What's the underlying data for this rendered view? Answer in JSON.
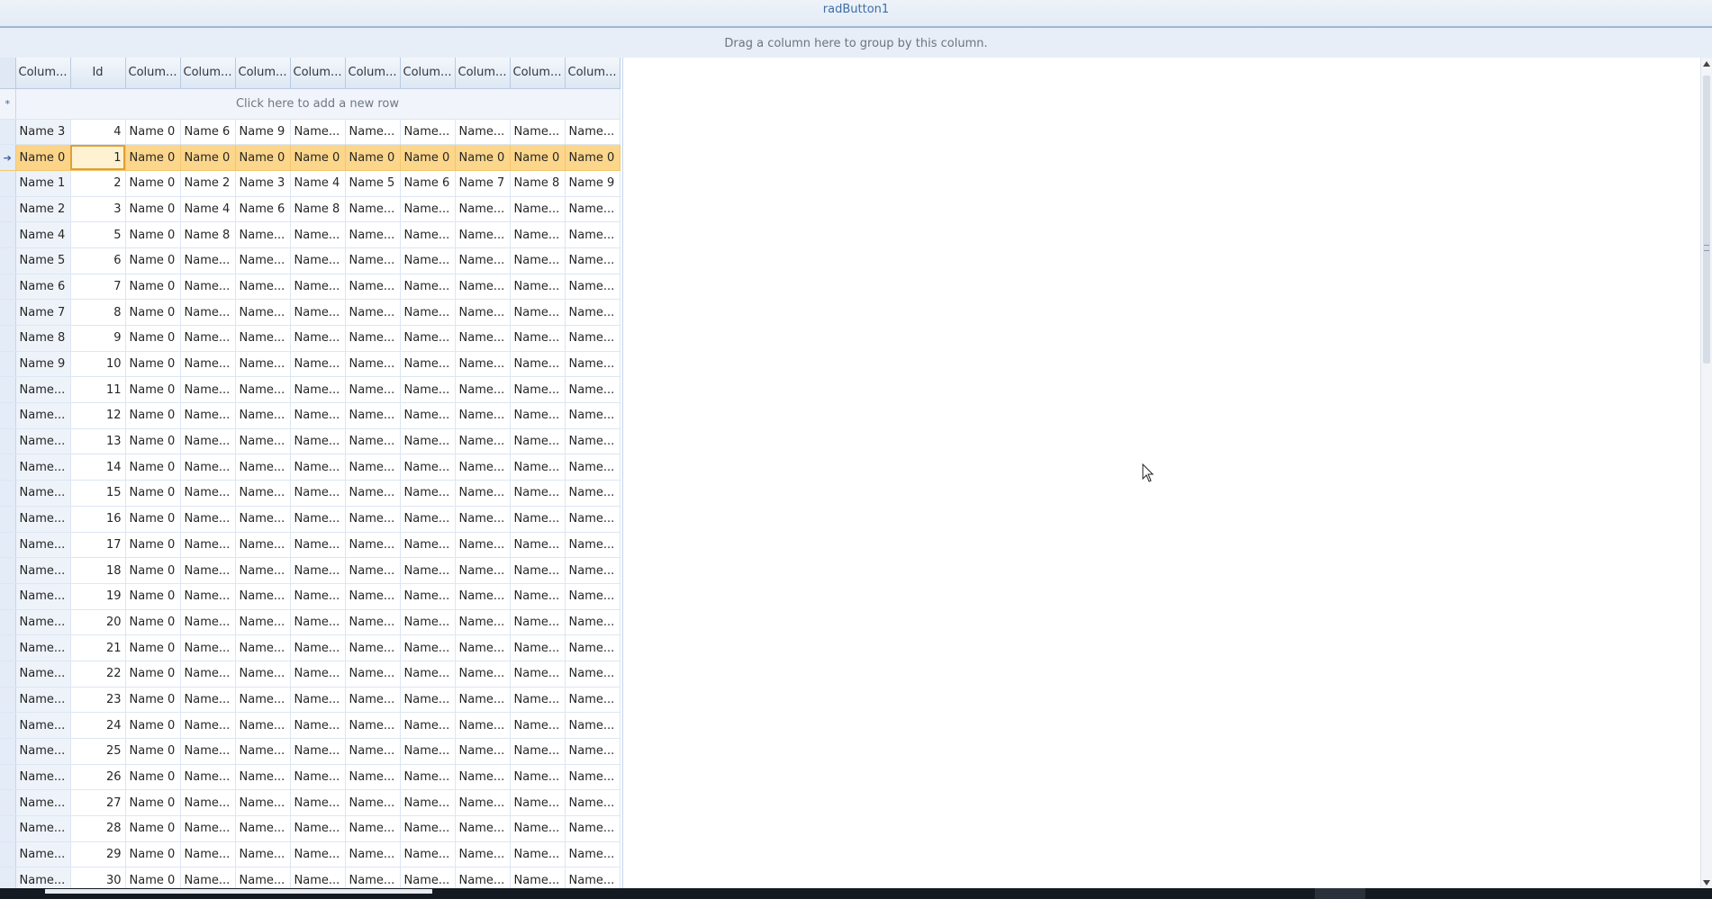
{
  "top_button": {
    "label": "radButton1"
  },
  "group_panel": {
    "text": "Drag a column here to group by this column."
  },
  "grid": {
    "columns": [
      "Colum...",
      "Id",
      "Colum...",
      "Colum...",
      "Colum...",
      "Colum...",
      "Colum...",
      "Colum...",
      "Colum...",
      "Colum...",
      "Colum..."
    ],
    "new_row_text": "Click here to add a new row",
    "new_row_marker": "*",
    "current_row_marker": "➔",
    "current_row_index": 1,
    "rows": [
      [
        "Name 3",
        "4",
        "Name 0",
        "Name 6",
        "Name 9",
        "Name...",
        "Name...",
        "Name...",
        "Name...",
        "Name...",
        "Name..."
      ],
      [
        "Name 0",
        "1",
        "Name 0",
        "Name 0",
        "Name 0",
        "Name 0",
        "Name 0",
        "Name 0",
        "Name 0",
        "Name 0",
        "Name 0"
      ],
      [
        "Name 1",
        "2",
        "Name 0",
        "Name 2",
        "Name 3",
        "Name 4",
        "Name 5",
        "Name 6",
        "Name 7",
        "Name 8",
        "Name 9"
      ],
      [
        "Name 2",
        "3",
        "Name 0",
        "Name 4",
        "Name 6",
        "Name 8",
        "Name...",
        "Name...",
        "Name...",
        "Name...",
        "Name..."
      ],
      [
        "Name 4",
        "5",
        "Name 0",
        "Name 8",
        "Name...",
        "Name...",
        "Name...",
        "Name...",
        "Name...",
        "Name...",
        "Name..."
      ],
      [
        "Name 5",
        "6",
        "Name 0",
        "Name...",
        "Name...",
        "Name...",
        "Name...",
        "Name...",
        "Name...",
        "Name...",
        "Name..."
      ],
      [
        "Name 6",
        "7",
        "Name 0",
        "Name...",
        "Name...",
        "Name...",
        "Name...",
        "Name...",
        "Name...",
        "Name...",
        "Name..."
      ],
      [
        "Name 7",
        "8",
        "Name 0",
        "Name...",
        "Name...",
        "Name...",
        "Name...",
        "Name...",
        "Name...",
        "Name...",
        "Name..."
      ],
      [
        "Name 8",
        "9",
        "Name 0",
        "Name...",
        "Name...",
        "Name...",
        "Name...",
        "Name...",
        "Name...",
        "Name...",
        "Name..."
      ],
      [
        "Name 9",
        "10",
        "Name 0",
        "Name...",
        "Name...",
        "Name...",
        "Name...",
        "Name...",
        "Name...",
        "Name...",
        "Name..."
      ],
      [
        "Name...",
        "11",
        "Name 0",
        "Name...",
        "Name...",
        "Name...",
        "Name...",
        "Name...",
        "Name...",
        "Name...",
        "Name..."
      ],
      [
        "Name...",
        "12",
        "Name 0",
        "Name...",
        "Name...",
        "Name...",
        "Name...",
        "Name...",
        "Name...",
        "Name...",
        "Name..."
      ],
      [
        "Name...",
        "13",
        "Name 0",
        "Name...",
        "Name...",
        "Name...",
        "Name...",
        "Name...",
        "Name...",
        "Name...",
        "Name..."
      ],
      [
        "Name...",
        "14",
        "Name 0",
        "Name...",
        "Name...",
        "Name...",
        "Name...",
        "Name...",
        "Name...",
        "Name...",
        "Name..."
      ],
      [
        "Name...",
        "15",
        "Name 0",
        "Name...",
        "Name...",
        "Name...",
        "Name...",
        "Name...",
        "Name...",
        "Name...",
        "Name..."
      ],
      [
        "Name...",
        "16",
        "Name 0",
        "Name...",
        "Name...",
        "Name...",
        "Name...",
        "Name...",
        "Name...",
        "Name...",
        "Name..."
      ],
      [
        "Name...",
        "17",
        "Name 0",
        "Name...",
        "Name...",
        "Name...",
        "Name...",
        "Name...",
        "Name...",
        "Name...",
        "Name..."
      ],
      [
        "Name...",
        "18",
        "Name 0",
        "Name...",
        "Name...",
        "Name...",
        "Name...",
        "Name...",
        "Name...",
        "Name...",
        "Name..."
      ],
      [
        "Name...",
        "19",
        "Name 0",
        "Name...",
        "Name...",
        "Name...",
        "Name...",
        "Name...",
        "Name...",
        "Name...",
        "Name..."
      ],
      [
        "Name...",
        "20",
        "Name 0",
        "Name...",
        "Name...",
        "Name...",
        "Name...",
        "Name...",
        "Name...",
        "Name...",
        "Name..."
      ],
      [
        "Name...",
        "21",
        "Name 0",
        "Name...",
        "Name...",
        "Name...",
        "Name...",
        "Name...",
        "Name...",
        "Name...",
        "Name..."
      ],
      [
        "Name...",
        "22",
        "Name 0",
        "Name...",
        "Name...",
        "Name...",
        "Name...",
        "Name...",
        "Name...",
        "Name...",
        "Name..."
      ],
      [
        "Name...",
        "23",
        "Name 0",
        "Name...",
        "Name...",
        "Name...",
        "Name...",
        "Name...",
        "Name...",
        "Name...",
        "Name..."
      ],
      [
        "Name...",
        "24",
        "Name 0",
        "Name...",
        "Name...",
        "Name...",
        "Name...",
        "Name...",
        "Name...",
        "Name...",
        "Name..."
      ],
      [
        "Name...",
        "25",
        "Name 0",
        "Name...",
        "Name...",
        "Name...",
        "Name...",
        "Name...",
        "Name...",
        "Name...",
        "Name..."
      ],
      [
        "Name...",
        "26",
        "Name 0",
        "Name...",
        "Name...",
        "Name...",
        "Name...",
        "Name...",
        "Name...",
        "Name...",
        "Name..."
      ],
      [
        "Name...",
        "27",
        "Name 0",
        "Name...",
        "Name...",
        "Name...",
        "Name...",
        "Name...",
        "Name...",
        "Name...",
        "Name..."
      ],
      [
        "Name...",
        "28",
        "Name 0",
        "Name...",
        "Name...",
        "Name...",
        "Name...",
        "Name...",
        "Name...",
        "Name...",
        "Name..."
      ],
      [
        "Name...",
        "29",
        "Name 0",
        "Name...",
        "Name...",
        "Name...",
        "Name...",
        "Name...",
        "Name...",
        "Name...",
        "Name..."
      ],
      [
        "Name...",
        "30",
        "Name 0",
        "Name...",
        "Name...",
        "Name...",
        "Name...",
        "Name...",
        "Name...",
        "Name...",
        "Name..."
      ]
    ]
  },
  "colors": {
    "header_text": "#3c6ea8",
    "current_row": "#fcd68b",
    "grid_line": "#dce6f3"
  }
}
